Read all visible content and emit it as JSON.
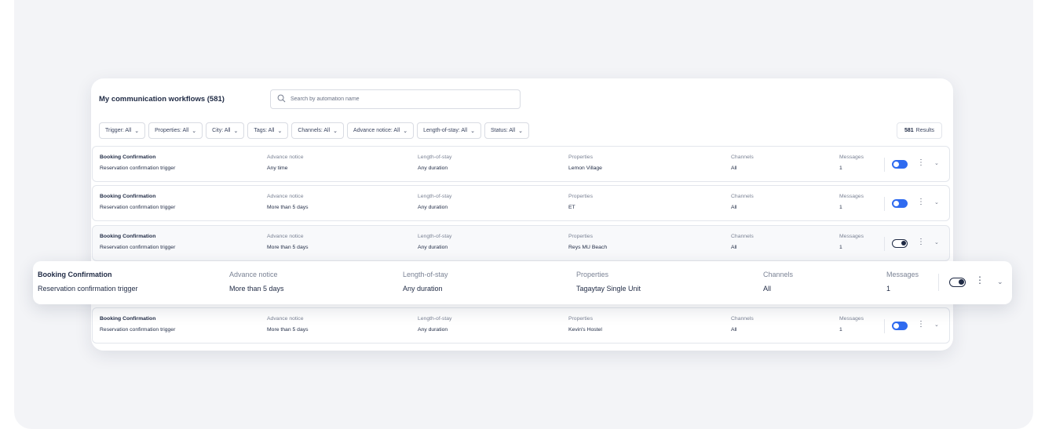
{
  "header": {
    "title": "My communication workflows (581)",
    "search_placeholder": "Search by automation name"
  },
  "filters": [
    "Trigger: All",
    "Properties: All",
    "City: All",
    "Tags: All",
    "Channels: All",
    "Advance notice: All",
    "Length-of-stay: All",
    "Status: All"
  ],
  "results": {
    "count": "581",
    "label": "Results"
  },
  "columns": {
    "advance": "Advance notice",
    "length": "Length-of-stay",
    "properties": "Properties",
    "channels": "Channels",
    "messages": "Messages"
  },
  "rows": [
    {
      "name": "Booking Confirmation",
      "trigger": "Reservation confirmation trigger",
      "advance": "Any time",
      "length": "Any duration",
      "property": "Lemon Village",
      "channels": "All",
      "messages": "1",
      "enabled": true
    },
    {
      "name": "Booking Confirmation",
      "trigger": "Reservation confirmation trigger",
      "advance": "More than 5 days",
      "length": "Any duration",
      "property": "ET",
      "channels": "All",
      "messages": "1",
      "enabled": true
    },
    {
      "name": "Booking Confirmation",
      "trigger": "Reservation confirmation trigger",
      "advance": "More than 5 days",
      "length": "Any duration",
      "property": "Reys MU Beach",
      "channels": "All",
      "messages": "1",
      "enabled": false
    },
    {
      "name": "Booking Confirmation",
      "trigger": "Reservation confirmation trigger",
      "advance": "More than 5 days",
      "length": "Any duration",
      "property": "Tagaytay Single Unit",
      "channels": "All",
      "messages": "1",
      "enabled": false
    },
    {
      "name": "Booking Confirmation",
      "trigger": "Reservation confirmation trigger",
      "advance": "More than 5 days",
      "length": "Any duration",
      "property": "Kevin's Hostel",
      "channels": "All",
      "messages": "1",
      "enabled": true
    }
  ],
  "icons": {
    "search": "search-icon",
    "chevron": "chevron-down-icon",
    "kebab": "kebab-menu-icon",
    "expand": "chevron-down-icon"
  },
  "colors": {
    "accent": "#2f6bf0",
    "text": "#1f2a44",
    "muted": "#7b8395"
  }
}
